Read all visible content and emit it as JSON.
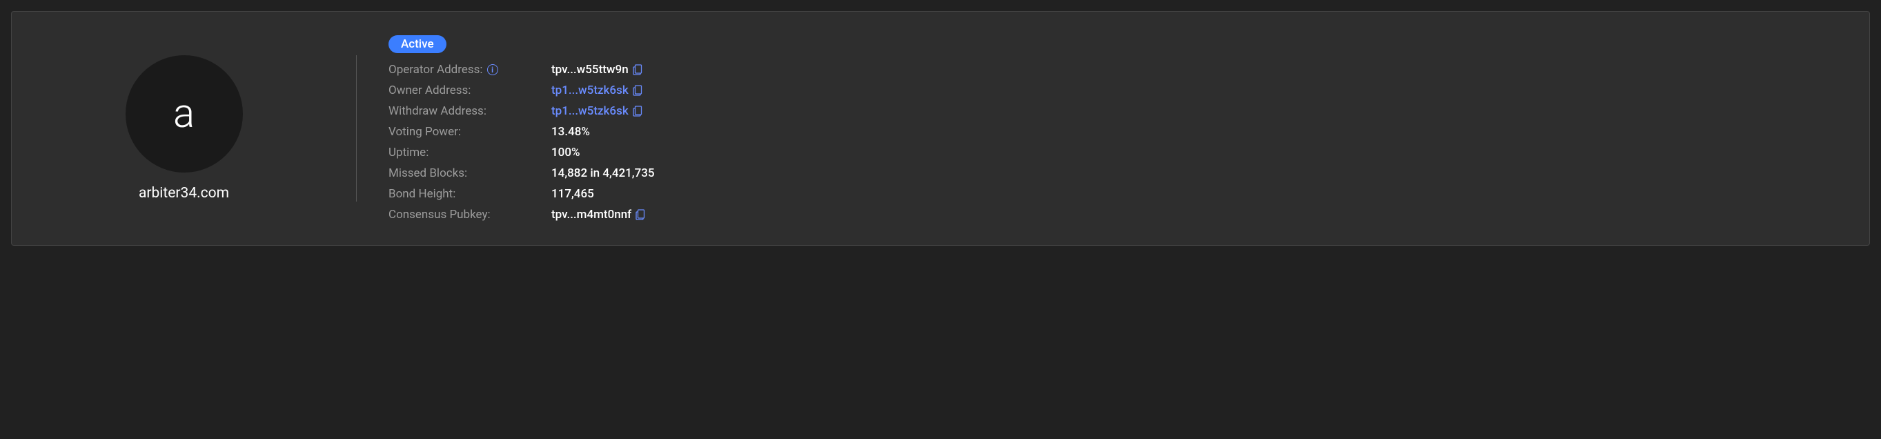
{
  "validator": {
    "avatar_letter": "a",
    "name": "arbiter34.com"
  },
  "status": {
    "badge": "Active"
  },
  "fields": {
    "operator_address": {
      "label": "Operator Address:",
      "value": "tpv...w55ttw9n"
    },
    "owner_address": {
      "label": "Owner Address:",
      "value": "tp1...w5tzk6sk"
    },
    "withdraw_address": {
      "label": "Withdraw Address:",
      "value": "tp1...w5tzk6sk"
    },
    "voting_power": {
      "label": "Voting Power:",
      "value": "13.48%"
    },
    "uptime": {
      "label": "Uptime:",
      "value": "100%"
    },
    "missed_blocks": {
      "label": "Missed Blocks:",
      "value": "14,882 in 4,421,735"
    },
    "bond_height": {
      "label": "Bond Height:",
      "value": "117,465"
    },
    "consensus_pubkey": {
      "label": "Consensus Pubkey:",
      "value": "tpv...m4mt0nnf"
    }
  }
}
